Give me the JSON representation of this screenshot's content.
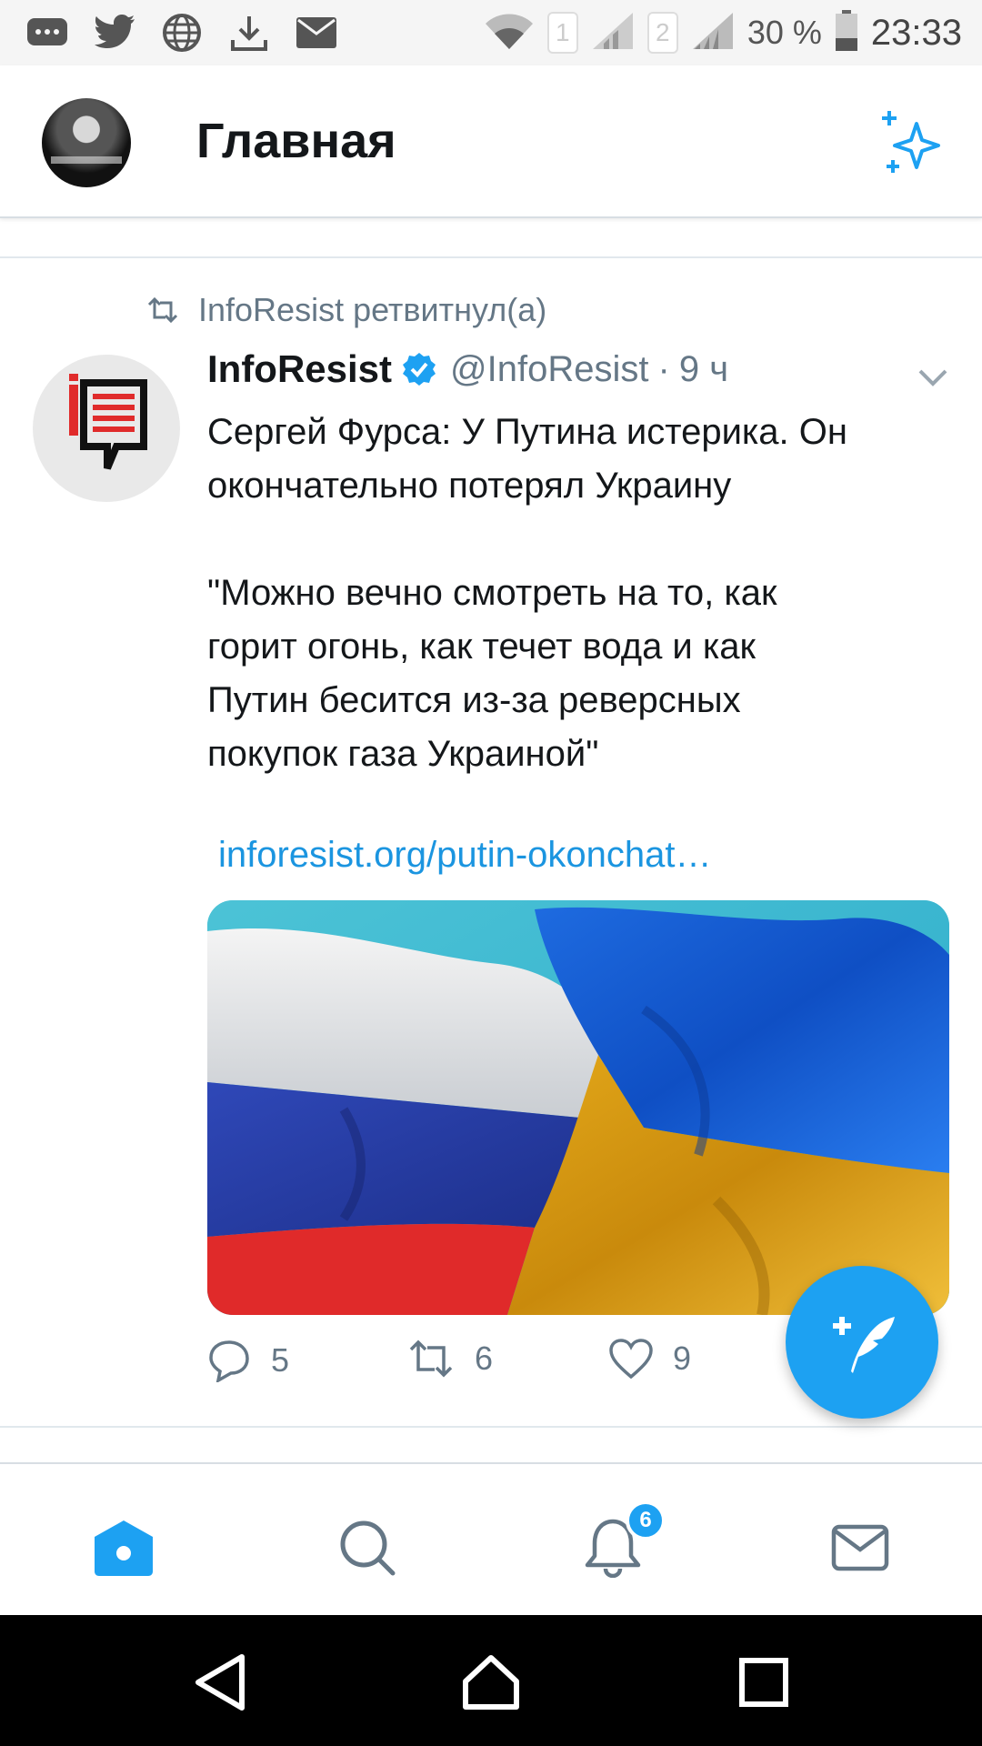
{
  "status_bar": {
    "icons": [
      "chat-icon",
      "twitter-icon",
      "globe-icon",
      "download-icon",
      "mail-icon",
      "wifi-icon",
      "signal-icon"
    ],
    "sim1": "1",
    "sim2": "2",
    "battery": "30 %",
    "time": "23:33"
  },
  "header": {
    "title": "Главная",
    "icon": "sparkle-icon"
  },
  "tweet": {
    "retweet_label": "InfoResist ретвитнул(а)",
    "author_name": "InfoResist",
    "verified": true,
    "handle": "@InfoResist",
    "separator": "·",
    "time": "9 ч",
    "text_line1": "Сергей Фурса: У Путина истерика. Он",
    "text_line2": "окончательно потерял Украину",
    "text_line3": "\"Можно вечно смотреть на то, как",
    "text_line4": "горит огонь, как течет вода и как",
    "text_line5": "Путин бесится из-за реверсных",
    "text_line6": "покупок газа Украиной\"",
    "link": "inforesist.org/putin-okonchat…",
    "image": "russian-and-ukrainian-flags",
    "replies": "5",
    "retweets": "6",
    "likes": "9"
  },
  "fab": {
    "icon": "compose-tweet-icon"
  },
  "tabbar": {
    "tabs": [
      "home-icon",
      "search-icon",
      "notifications-icon",
      "messages-icon"
    ],
    "notification_count": "6"
  },
  "colors": {
    "accent": "#1da1f2",
    "link": "#1b95e0",
    "secondary_text": "#657786"
  }
}
